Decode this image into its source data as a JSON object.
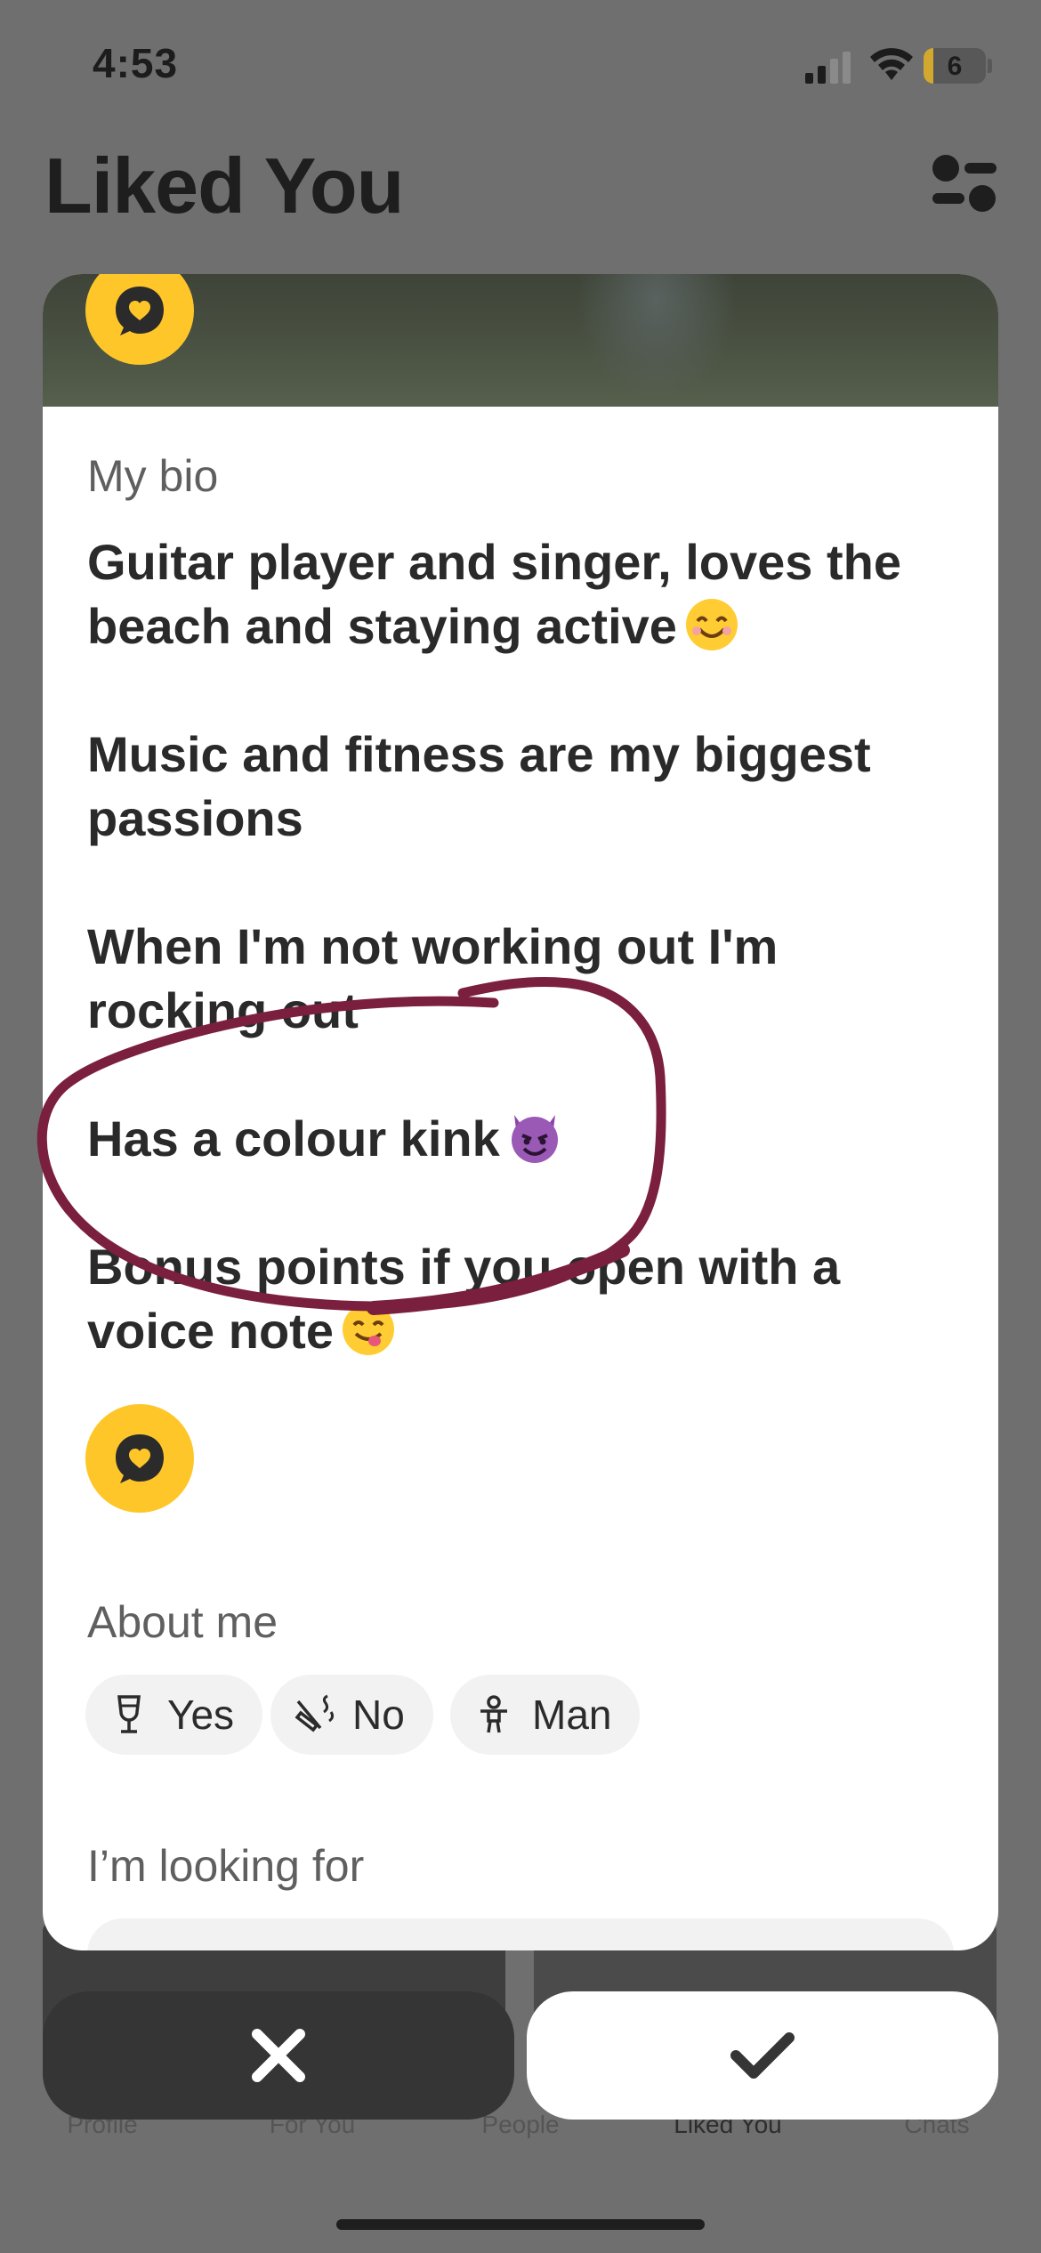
{
  "status_bar": {
    "time": "4:53",
    "battery": "6"
  },
  "header": {
    "title": "Liked You",
    "filter_icon": "filter-sliders-icon"
  },
  "card": {
    "bio_label": "My bio",
    "bio_paragraphs": [
      "Guitar player and singer, loves the beach and staying active",
      "Music and fitness are my biggest passions",
      "When I'm not working out I'm rocking out",
      "Has a colour kink",
      "Bonus points if you open with a voice note"
    ],
    "prompt_icon": "heart-speech-bubble-icon",
    "about_label": "About me",
    "about_chips": [
      {
        "icon": "wine-glass-icon",
        "label": "Yes"
      },
      {
        "icon": "no-smoking-icon",
        "label": "No"
      },
      {
        "icon": "person-icon",
        "label": "Man"
      }
    ],
    "looking_label": "I’m looking for"
  },
  "actions": {
    "pass_icon": "close-x-icon",
    "like_icon": "checkmark-icon"
  },
  "nav": [
    {
      "label": "Profile"
    },
    {
      "label": "For You"
    },
    {
      "label": "People"
    },
    {
      "label": "Liked You",
      "active": true
    },
    {
      "label": "Chats"
    }
  ],
  "colors": {
    "accent_yellow": "#ffc629",
    "overlay": "#6f6f6f",
    "annotation_stroke": "#7a1f3d"
  }
}
